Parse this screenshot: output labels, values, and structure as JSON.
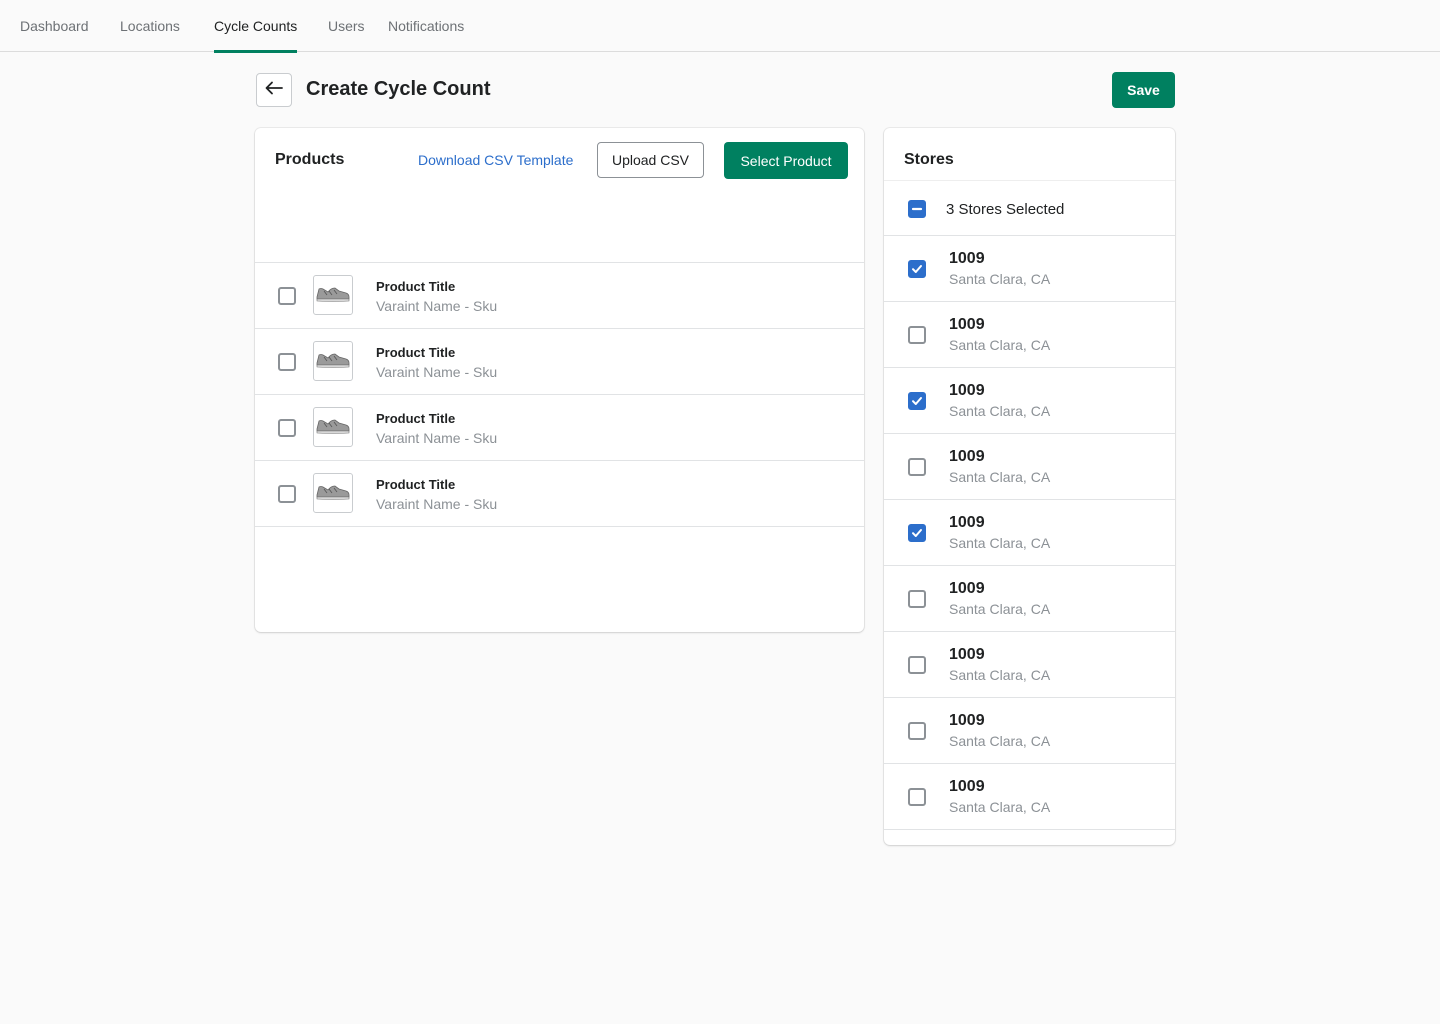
{
  "nav": {
    "tabs": [
      {
        "label": "Dashboard",
        "active": false
      },
      {
        "label": "Locations",
        "active": false
      },
      {
        "label": "Cycle Counts",
        "active": true
      },
      {
        "label": "Users",
        "active": false
      },
      {
        "label": "Notifications",
        "active": false
      }
    ]
  },
  "header": {
    "back_icon": "arrow-left-icon",
    "title": "Create Cycle Count",
    "save_label": "Save"
  },
  "colors": {
    "primary": "#008060",
    "link": "#2c6ecb",
    "checkbox_checked": "#2c6ecb"
  },
  "products": {
    "heading": "Products",
    "download_label": "Download CSV Template",
    "upload_label": "Upload CSV",
    "select_label": "Select Product",
    "items": [
      {
        "title": "Product Title",
        "subtitle": "Varaint Name - Sku",
        "checked": false,
        "thumb_icon": "sneaker-icon"
      },
      {
        "title": "Product Title",
        "subtitle": "Varaint Name - Sku",
        "checked": false,
        "thumb_icon": "sneaker-icon"
      },
      {
        "title": "Product Title",
        "subtitle": "Varaint Name - Sku",
        "checked": false,
        "thumb_icon": "sneaker-icon"
      },
      {
        "title": "Product Title",
        "subtitle": "Varaint Name - Sku",
        "checked": false,
        "thumb_icon": "sneaker-icon"
      }
    ]
  },
  "stores": {
    "heading": "Stores",
    "select_all_label": "3 Stores Selected",
    "select_all_state": "indeterminate",
    "items": [
      {
        "id": "1009",
        "location": "Santa Clara, CA",
        "checked": true
      },
      {
        "id": "1009",
        "location": "Santa Clara, CA",
        "checked": false
      },
      {
        "id": "1009",
        "location": "Santa Clara, CA",
        "checked": true
      },
      {
        "id": "1009",
        "location": "Santa Clara, CA",
        "checked": false
      },
      {
        "id": "1009",
        "location": "Santa Clara, CA",
        "checked": true
      },
      {
        "id": "1009",
        "location": "Santa Clara, CA",
        "checked": false
      },
      {
        "id": "1009",
        "location": "Santa Clara, CA",
        "checked": false
      },
      {
        "id": "1009",
        "location": "Santa Clara, CA",
        "checked": false
      },
      {
        "id": "1009",
        "location": "Santa Clara, CA",
        "checked": false
      }
    ]
  }
}
